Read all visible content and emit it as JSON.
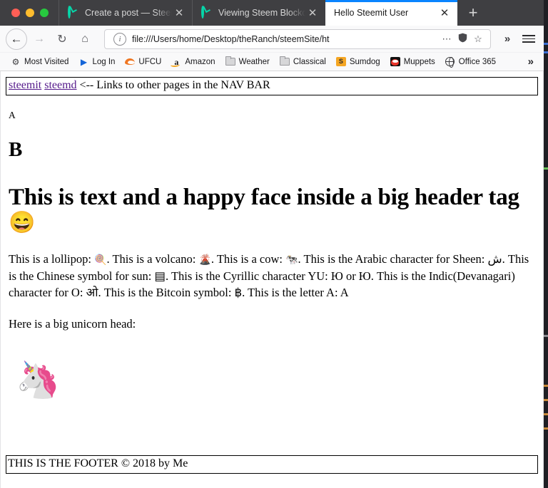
{
  "window": {
    "traffic_lights": [
      "close",
      "minimize",
      "zoom"
    ],
    "colors": {
      "close": "#ff5f56",
      "minimize": "#ffbd2e",
      "zoom": "#27c93f",
      "active_tab_accent": "#0a84ff",
      "chrome": "#3f3f42",
      "link_visited": "#551a8b"
    }
  },
  "tabs": [
    {
      "title": "Create a post — Steemit",
      "favicon": "steemit-logo-icon",
      "active": false,
      "close_label": "✕"
    },
    {
      "title": "Viewing Steem Blockchain",
      "favicon": "steemit-logo-icon",
      "active": false,
      "close_label": "✕"
    },
    {
      "title": "Hello Steemit User",
      "favicon": "",
      "active": true,
      "close_label": "✕"
    }
  ],
  "new_tab_label": "+",
  "toolbar": {
    "back_label": "←",
    "forward_label": "→",
    "reload_label": "↻",
    "home_label": "⌂",
    "url": "file:///Users/home/Desktop/theRanch/steemSite/ht",
    "info_label": "i",
    "page_actions_label": "⋯",
    "shield_label": "⬡",
    "bookmark_star_label": "☆",
    "overflow_label": "»",
    "menu_label": "menu"
  },
  "bookmarks": {
    "items": [
      {
        "label": "Most Visited",
        "icon": "gear-icon"
      },
      {
        "label": "Log In",
        "icon": "play-triangle-icon"
      },
      {
        "label": "UFCU",
        "icon": "ufcu-swoosh-icon"
      },
      {
        "label": "Amazon",
        "icon": "amazon-a-icon"
      },
      {
        "label": "Weather",
        "icon": "folder-icon"
      },
      {
        "label": "Classical",
        "icon": "folder-icon"
      },
      {
        "label": "Sumdog",
        "icon": "sumdog-icon"
      },
      {
        "label": "Muppets",
        "icon": "elmo-icon"
      },
      {
        "label": "Office 365",
        "icon": "globe-icon"
      }
    ],
    "overflow_label": "»"
  },
  "page": {
    "nav": {
      "links": [
        {
          "label": "steemit"
        },
        {
          "label": "steemd"
        }
      ],
      "note": "<-- Links to other pages in the NAV BAR"
    },
    "small_heading": "A",
    "medium_heading": "B",
    "big_heading": "This is text and a happy face inside a big header tag",
    "happy_face": "😄",
    "paragraph": {
      "s1": "This is a lollipop: ",
      "e1": "🍭",
      "s2": ". This is a volcano: ",
      "e2": "🌋",
      "s3": ". This is a cow: ",
      "e3": "🐄",
      "s4": ". This is the Arabic character for Sheen: ",
      "e4": "ش",
      "s5": ". This is the Chinese symbol for sun: ",
      "e5": "▤",
      "s6": ". This is the Cyrillic character YU: Ю or Ю. This is the Indic(Devanagari) character for O: ",
      "e6": "ओ",
      "s7": ". This is the Bitcoin symbol: ",
      "e7": "฿",
      "s8": ". This is the letter A: A"
    },
    "unicorn_caption": "Here is a big unicorn head:",
    "unicorn_emoji": "🦄",
    "footer": "THIS IS THE FOOTER © 2018 by Me"
  }
}
